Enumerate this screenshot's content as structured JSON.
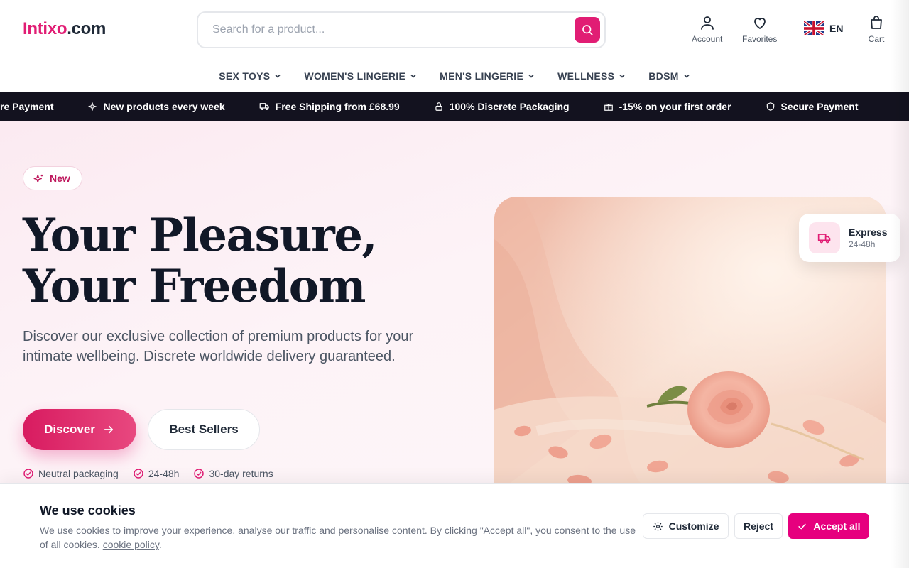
{
  "header": {
    "logo_brand": "Intixo",
    "logo_tld": ".com",
    "search_placeholder": "Search for a product...",
    "account_label": "Account",
    "favorites_label": "Favorites",
    "language_code": "EN",
    "cart_label": "Cart"
  },
  "nav": {
    "items": [
      {
        "label": "SEX TOYS"
      },
      {
        "label": "WOMEN'S LINGERIE"
      },
      {
        "label": "MEN'S LINGERIE"
      },
      {
        "label": "WELLNESS"
      },
      {
        "label": "BDSM"
      }
    ]
  },
  "ticker": {
    "items": [
      {
        "label": "re Payment",
        "icon": "shield-icon"
      },
      {
        "label": "New products every week",
        "icon": "sparkle-icon"
      },
      {
        "label": "Free Shipping from £68.99",
        "icon": "truck-icon"
      },
      {
        "label": "100% Discrete Packaging",
        "icon": "lock-icon"
      },
      {
        "label": "-15% on your first order",
        "icon": "gift-icon"
      },
      {
        "label": "Secure Payment",
        "icon": "shield-icon"
      }
    ]
  },
  "hero": {
    "badge": "New",
    "title_line1": "Your Pleasure,",
    "title_line2": "Your Freedom",
    "description": "Discover our exclusive collection of premium products for your intimate wellbeing. Discrete worldwide delivery guaranteed.",
    "discover_label": "Discover",
    "bestsellers_label": "Best Sellers",
    "perks": [
      "Neutral packaging",
      "24-48h",
      "30-day returns"
    ],
    "express_title": "Express",
    "express_sub": "24-48h"
  },
  "cookie": {
    "title": "We use cookies",
    "text": "We use cookies to improve your experience, analyse our traffic and personalise content. By clicking \"Accept all\", you consent to the use of all cookies.",
    "policy_link": "cookie policy",
    "customize_label": "Customize",
    "reject_label": "Reject",
    "accept_label": "Accept all"
  },
  "colors": {
    "accent": "#e11d74",
    "ticker_bg": "#13121f",
    "hero_bg": "#fbeaf1"
  }
}
